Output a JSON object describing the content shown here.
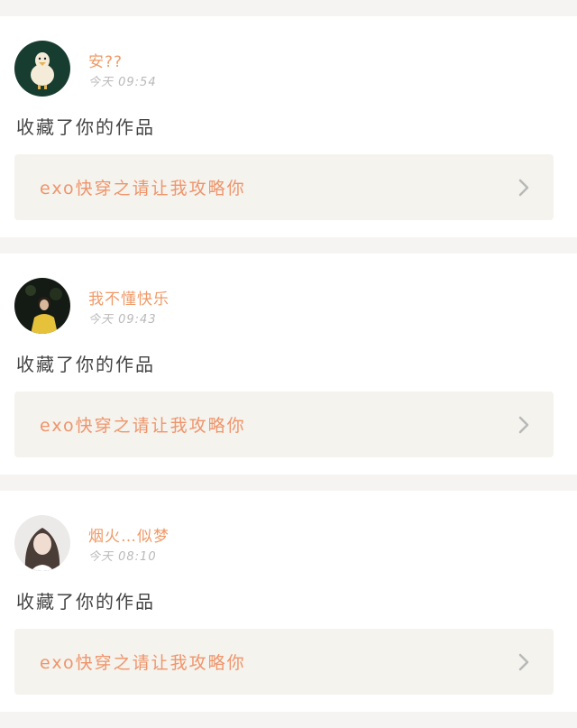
{
  "notifications": [
    {
      "username": "安??",
      "time": "今天  09:54",
      "message": "收藏了你的作品",
      "work_title": "exo快穿之请让我攻略你",
      "avatar_icon": "duck-avatar-icon"
    },
    {
      "username": "我不懂快乐",
      "time": "今天  09:43",
      "message": "收藏了你的作品",
      "work_title": "exo快穿之请让我攻略你",
      "avatar_icon": "girl-yellow-avatar-icon"
    },
    {
      "username": "烟火…似梦",
      "time": "今天  08:10",
      "message": "收藏了你的作品",
      "work_title": "exo快穿之请让我攻略你",
      "avatar_icon": "girl-portrait-avatar-icon"
    }
  ],
  "colors": {
    "username": "#ef9a67",
    "work_title": "#f0946a",
    "time": "#b9b9b9",
    "card_link_bg": "#f4f3ee",
    "page_bg": "#f6f4f3"
  }
}
